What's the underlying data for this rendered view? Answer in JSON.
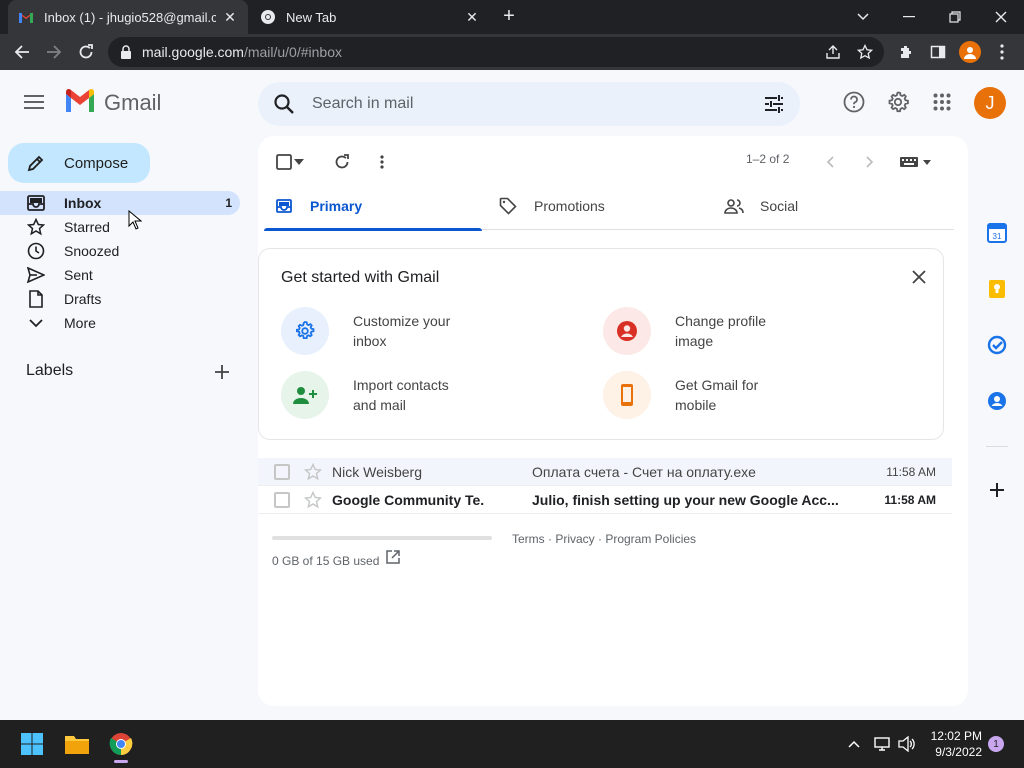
{
  "browser": {
    "tabs": [
      {
        "title": "Inbox (1) - jhugio528@gmail.com",
        "active": true
      },
      {
        "title": "New Tab",
        "active": false
      }
    ],
    "url_host": "mail.google.com",
    "url_path": "/mail/u/0/#inbox"
  },
  "gmail": {
    "logo_text": "Gmail",
    "search_placeholder": "Search in mail",
    "avatar_letter": "J",
    "compose_label": "Compose",
    "nav": [
      {
        "label": "Inbox",
        "icon": "inbox-icon",
        "count": "1",
        "active": true
      },
      {
        "label": "Starred",
        "icon": "star-icon",
        "count": "",
        "active": false
      },
      {
        "label": "Snoozed",
        "icon": "clock-icon",
        "count": "",
        "active": false
      },
      {
        "label": "Sent",
        "icon": "send-icon",
        "count": "",
        "active": false
      },
      {
        "label": "Drafts",
        "icon": "draft-icon",
        "count": "",
        "active": false
      },
      {
        "label": "More",
        "icon": "chevron-down-icon",
        "count": "",
        "active": false
      }
    ],
    "labels_heading": "Labels",
    "page_count": "1–2 of 2",
    "tabs": [
      {
        "label": "Primary",
        "icon": "inbox-icon",
        "active": true
      },
      {
        "label": "Promotions",
        "icon": "tag-icon",
        "active": false
      },
      {
        "label": "Social",
        "icon": "people-icon",
        "active": false
      }
    ],
    "get_started": {
      "title": "Get started with Gmail",
      "items": [
        {
          "label_line1": "Customize your",
          "label_line2": "inbox",
          "icon": "gear-icon"
        },
        {
          "label_line1": "Change profile",
          "label_line2": "image",
          "icon": "account-icon"
        },
        {
          "label_line1": "Import contacts",
          "label_line2": "and mail",
          "icon": "person-add-icon"
        },
        {
          "label_line1": "Get Gmail for",
          "label_line2": "mobile",
          "icon": "phone-icon"
        }
      ]
    },
    "emails": [
      {
        "from": "Nick Weisberg",
        "subject": "Оплата счета - Счет на оплату.exe",
        "time": "11:58 AM",
        "unread": false
      },
      {
        "from": "Google Community Te.",
        "subject": "Julio, finish setting up your new Google Acc...",
        "time": "11:58 AM",
        "unread": true
      }
    ],
    "storage_text": "0 GB of 15 GB used",
    "storage_used_fraction": 0.0,
    "footer_links": "Terms · Privacy · Program Policies"
  },
  "taskbar": {
    "time": "12:02 PM",
    "date": "9/3/2022",
    "notification_count": "1"
  },
  "colors": {
    "brand_blue": "#0b57d0",
    "compose_bg": "#c2e7ff",
    "active_nav_bg": "#d3e3fd",
    "avatar_orange": "#e8710a"
  }
}
